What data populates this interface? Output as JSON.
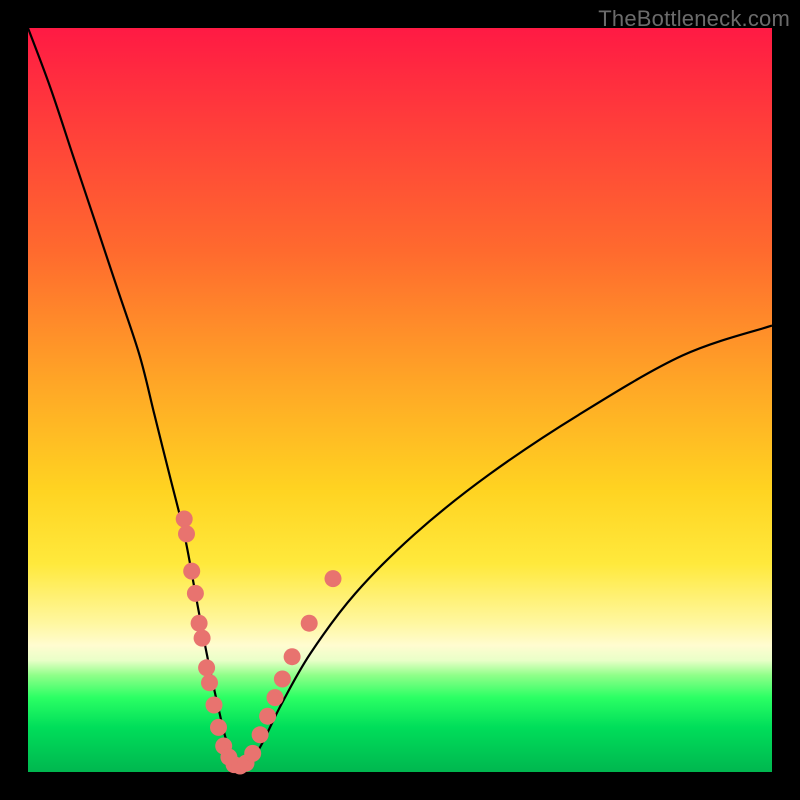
{
  "watermark": "TheBottleneck.com",
  "chart_data": {
    "type": "line",
    "title": "",
    "xlabel": "",
    "ylabel": "",
    "xlim": [
      0,
      100
    ],
    "ylim": [
      0,
      100
    ],
    "grid": false,
    "legend": false,
    "series": [
      {
        "name": "bottleneck-curve",
        "x": [
          0,
          3,
          6,
          9,
          12,
          15,
          17,
          19,
          21,
          22.5,
          24,
          25.5,
          27,
          28.5,
          31,
          34,
          38,
          44,
          52,
          62,
          74,
          88,
          100
        ],
        "y": [
          100,
          92,
          83,
          74,
          65,
          56,
          48,
          40,
          32,
          24,
          16,
          9,
          3,
          0,
          3,
          9,
          16,
          24,
          32,
          40,
          48,
          56,
          60
        ]
      }
    ],
    "markers": [
      {
        "x": 21.0,
        "y": 34
      },
      {
        "x": 21.3,
        "y": 32
      },
      {
        "x": 22.0,
        "y": 27
      },
      {
        "x": 22.5,
        "y": 24
      },
      {
        "x": 23.0,
        "y": 20
      },
      {
        "x": 23.4,
        "y": 18
      },
      {
        "x": 24.0,
        "y": 14
      },
      {
        "x": 24.4,
        "y": 12
      },
      {
        "x": 25.0,
        "y": 9
      },
      {
        "x": 25.6,
        "y": 6
      },
      {
        "x": 26.3,
        "y": 3.5
      },
      {
        "x": 27.0,
        "y": 2
      },
      {
        "x": 27.7,
        "y": 1
      },
      {
        "x": 28.5,
        "y": 0.8
      },
      {
        "x": 29.3,
        "y": 1.2
      },
      {
        "x": 30.2,
        "y": 2.5
      },
      {
        "x": 31.2,
        "y": 5
      },
      {
        "x": 32.2,
        "y": 7.5
      },
      {
        "x": 33.2,
        "y": 10
      },
      {
        "x": 34.2,
        "y": 12.5
      },
      {
        "x": 35.5,
        "y": 15.5
      },
      {
        "x": 37.8,
        "y": 20
      },
      {
        "x": 41.0,
        "y": 26
      }
    ],
    "marker_color": "#e8736f",
    "curve_color": "#000000"
  }
}
